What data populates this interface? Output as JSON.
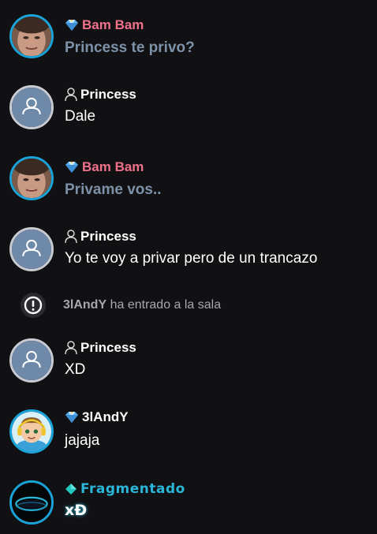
{
  "colors": {
    "background": "#111113",
    "vip_name": "#f0718a",
    "vip_text": "#7d92a8",
    "user_name": "#ffffff",
    "user_text": "#ffffff",
    "special_name": "#2ab6d8",
    "accent_ring": "#1aa3d9"
  },
  "messages": [
    {
      "user": "Bam Bam",
      "badge": "diamond-icon",
      "text": "Princess te privo?"
    },
    {
      "user": "Princess",
      "badge": "user-outline-icon",
      "text": "Dale"
    },
    {
      "user": "Bam Bam",
      "badge": "diamond-icon",
      "text": "Privame vos.."
    },
    {
      "user": "Princess",
      "badge": "user-outline-icon",
      "text": "Yo te voy a privar pero de un trancazo"
    },
    {
      "user": "Princess",
      "badge": "user-outline-icon",
      "text": "XD"
    },
    {
      "user": "3lAndY",
      "badge": "diamond-icon",
      "text": "jajaja"
    },
    {
      "user": "Fragmentado",
      "badge": "cyan-gem-icon",
      "text": "xÐ"
    }
  ],
  "system_message": {
    "icon": "alert-circle-icon",
    "user": "3lAndY",
    "text": "ha entrado a la sala"
  }
}
